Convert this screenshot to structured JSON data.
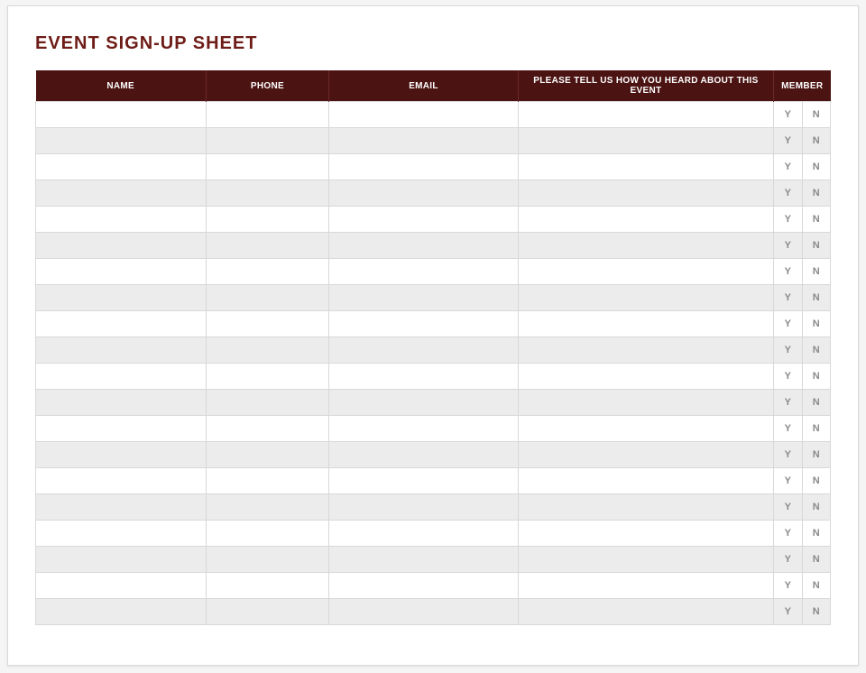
{
  "title": "EVENT SIGN-UP SHEET",
  "columns": {
    "name": "NAME",
    "phone": "PHONE",
    "email": "EMAIL",
    "heard": "PLEASE TELL US HOW YOU HEARD ABOUT THIS EVENT",
    "member": "MEMBER"
  },
  "yn": {
    "y": "Y",
    "n": "N"
  },
  "rows": [
    {
      "name": "",
      "phone": "",
      "email": "",
      "heard": ""
    },
    {
      "name": "",
      "phone": "",
      "email": "",
      "heard": ""
    },
    {
      "name": "",
      "phone": "",
      "email": "",
      "heard": ""
    },
    {
      "name": "",
      "phone": "",
      "email": "",
      "heard": ""
    },
    {
      "name": "",
      "phone": "",
      "email": "",
      "heard": ""
    },
    {
      "name": "",
      "phone": "",
      "email": "",
      "heard": ""
    },
    {
      "name": "",
      "phone": "",
      "email": "",
      "heard": ""
    },
    {
      "name": "",
      "phone": "",
      "email": "",
      "heard": ""
    },
    {
      "name": "",
      "phone": "",
      "email": "",
      "heard": ""
    },
    {
      "name": "",
      "phone": "",
      "email": "",
      "heard": ""
    },
    {
      "name": "",
      "phone": "",
      "email": "",
      "heard": ""
    },
    {
      "name": "",
      "phone": "",
      "email": "",
      "heard": ""
    },
    {
      "name": "",
      "phone": "",
      "email": "",
      "heard": ""
    },
    {
      "name": "",
      "phone": "",
      "email": "",
      "heard": ""
    },
    {
      "name": "",
      "phone": "",
      "email": "",
      "heard": ""
    },
    {
      "name": "",
      "phone": "",
      "email": "",
      "heard": ""
    },
    {
      "name": "",
      "phone": "",
      "email": "",
      "heard": ""
    },
    {
      "name": "",
      "phone": "",
      "email": "",
      "heard": ""
    },
    {
      "name": "",
      "phone": "",
      "email": "",
      "heard": ""
    },
    {
      "name": "",
      "phone": "",
      "email": "",
      "heard": ""
    }
  ]
}
